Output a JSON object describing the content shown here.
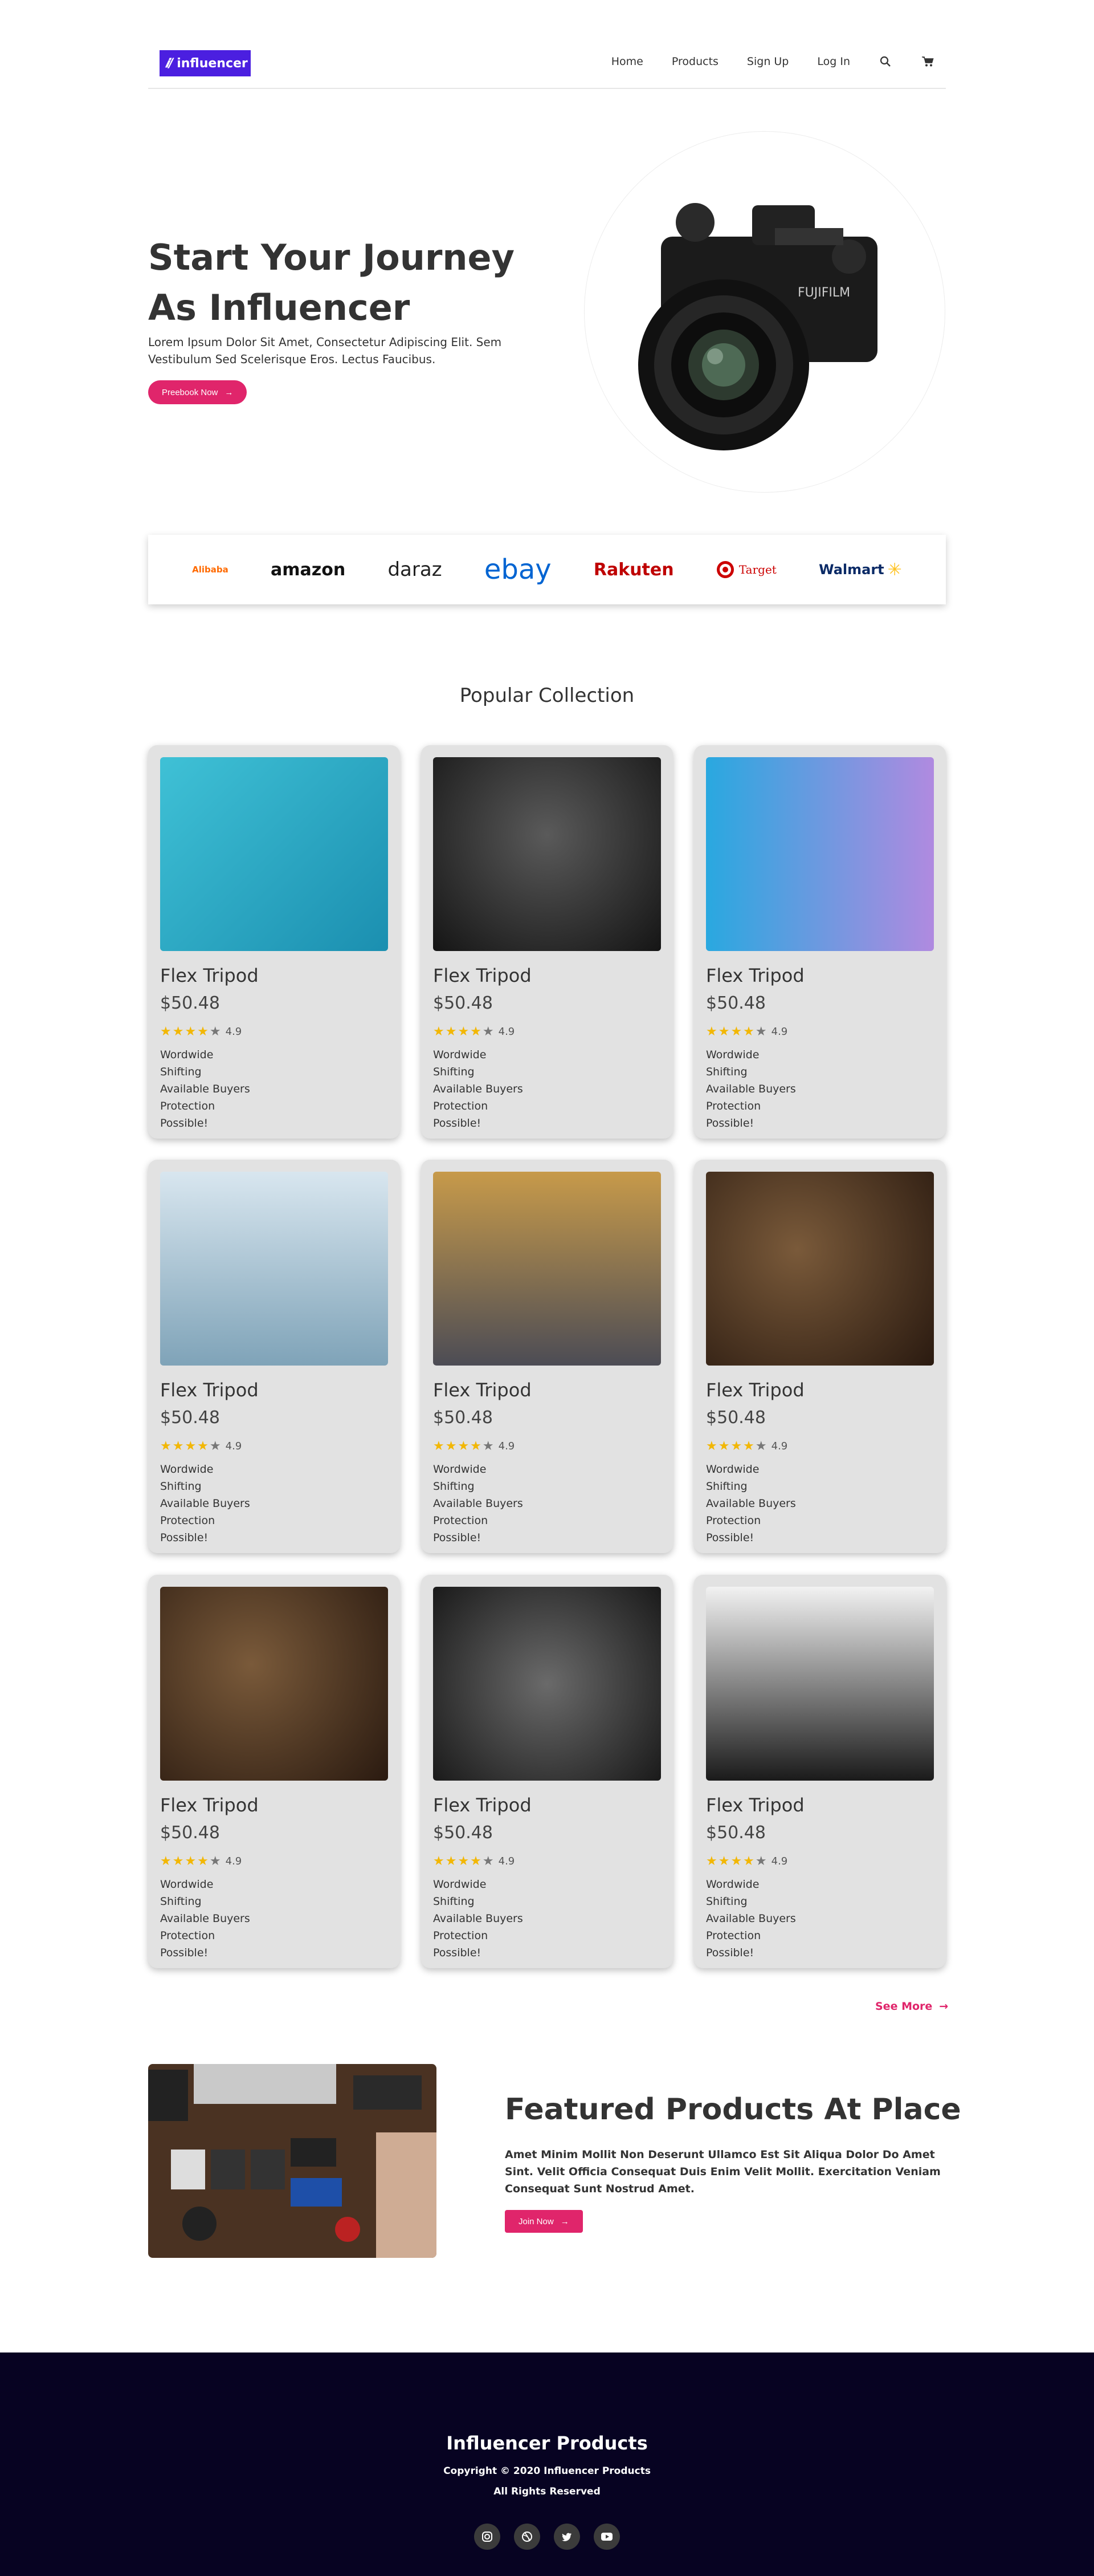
{
  "nav": {
    "logo_text": "influencer",
    "items": [
      "Home",
      "Products",
      "Sign Up",
      "Log In"
    ],
    "icons": [
      "search-icon",
      "cart-icon"
    ]
  },
  "hero": {
    "title_line1": "Start Your Journey",
    "title_line2": "As Influencer",
    "text": "Lorem Ipsum Dolor Sit Amet, Consectetur Adipiscing Elit. Sem Vestibulum Sed Scelerisque Eros. Lectus Faucibus.",
    "button": "Preebook Now"
  },
  "brands": [
    "Alibaba",
    "amazon",
    "daraz",
    "ebay",
    "Rakuten",
    "Target",
    "Walmart"
  ],
  "collection": {
    "title": "Popular Collection",
    "products": [
      {
        "name": "Flex Tripod",
        "price": "$50.48",
        "rating": "4.9",
        "desc": [
          "Wordwide",
          "Shifting",
          "Available Buyers",
          "Protection",
          "Possible!"
        ]
      },
      {
        "name": "Flex Tripod",
        "price": "$50.48",
        "rating": "4.9",
        "desc": [
          "Wordwide",
          "Shifting",
          "Available Buyers",
          "Protection",
          "Possible!"
        ]
      },
      {
        "name": "Flex Tripod",
        "price": "$50.48",
        "rating": "4.9",
        "desc": [
          "Wordwide",
          "Shifting",
          "Available Buyers",
          "Protection",
          "Possible!"
        ]
      },
      {
        "name": "Flex Tripod",
        "price": "$50.48",
        "rating": "4.9",
        "desc": [
          "Wordwide",
          "Shifting",
          "Available Buyers",
          "Protection",
          "Possible!"
        ]
      },
      {
        "name": "Flex Tripod",
        "price": "$50.48",
        "rating": "4.9",
        "desc": [
          "Wordwide",
          "Shifting",
          "Available Buyers",
          "Protection",
          "Possible!"
        ]
      },
      {
        "name": "Flex Tripod",
        "price": "$50.48",
        "rating": "4.9",
        "desc": [
          "Wordwide",
          "Shifting",
          "Available Buyers",
          "Protection",
          "Possible!"
        ]
      },
      {
        "name": "Flex Tripod",
        "price": "$50.48",
        "rating": "4.9",
        "desc": [
          "Wordwide",
          "Shifting",
          "Available Buyers",
          "Protection",
          "Possible!"
        ]
      },
      {
        "name": "Flex Tripod",
        "price": "$50.48",
        "rating": "4.9",
        "desc": [
          "Wordwide",
          "Shifting",
          "Available Buyers",
          "Protection",
          "Possible!"
        ]
      },
      {
        "name": "Flex Tripod",
        "price": "$50.48",
        "rating": "4.9",
        "desc": [
          "Wordwide",
          "Shifting",
          "Available Buyers",
          "Protection",
          "Possible!"
        ]
      }
    ],
    "see_more": "See More"
  },
  "featured": {
    "title": "Featured Products At Place",
    "text": "Amet Minim Mollit Non Deserunt Ullamco Est Sit Aliqua Dolor Do Amet Sint. Velit Officia Consequat Duis Enim Velit Mollit. Exercitation Veniam Consequat Sunt Nostrud Amet.",
    "button": "Join Now"
  },
  "footer": {
    "title": "Influencer Products",
    "copyright": "Copyright © 2020 Influencer Products",
    "rights": "All Rights Reserved",
    "socials": [
      "instagram-icon",
      "dribbble-icon",
      "twitter-icon",
      "youtube-icon"
    ]
  },
  "colors": {
    "accent": "#e0256b",
    "brand": "#4b1fe0",
    "footer_bg": "#070322",
    "star": "#f2b705"
  }
}
